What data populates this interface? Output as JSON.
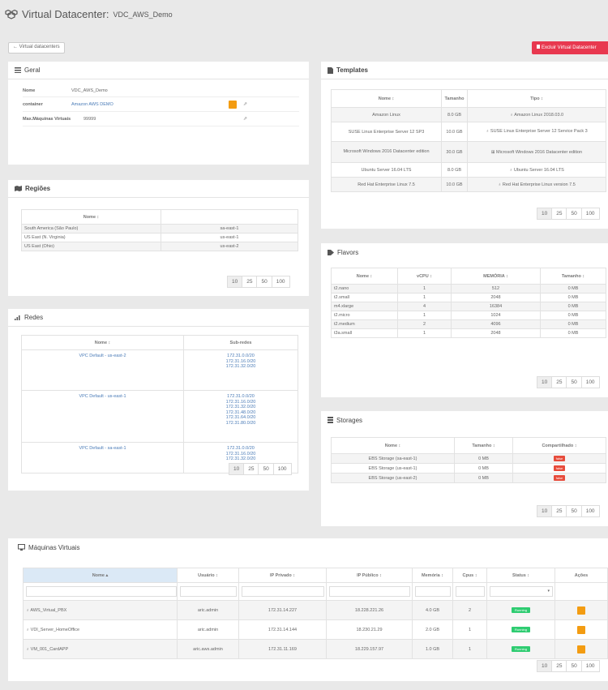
{
  "page": {
    "title_prefix": "Virtual Datacenter:",
    "title_name": "VDC_AWS_Demo"
  },
  "toolbar": {
    "back_label": "← Virtual datacenters",
    "delete_label": "Excluir Virtual Datacenter"
  },
  "geral": {
    "heading": "Geral",
    "rows": [
      {
        "label": "Nome",
        "value": "VDC_AWS_Demo"
      },
      {
        "label": "container",
        "value": "Amazon AWS DEMO"
      },
      {
        "label": "Max.Máquinas Virtuais",
        "value": "99999"
      }
    ]
  },
  "regioes": {
    "heading": "Regiões",
    "headers": [
      "Nome ↕",
      ""
    ],
    "rows": [
      [
        "South America (São Paulo)",
        "sa-east-1"
      ],
      [
        "US East (N. Virginia)",
        "us-east-1"
      ],
      [
        "US East (Ohio)",
        "us-east-2"
      ]
    ]
  },
  "redes": {
    "heading": "Redes",
    "headers": [
      "Nome ↕",
      "Sub-redes"
    ],
    "rows": [
      {
        "name": "VPC Default - us-east-2",
        "subnets": [
          "172.31.0.0/20",
          "172.31.16.0/20",
          "172.31.32.0/20"
        ]
      },
      {
        "name": "VPC Default - us-east-1",
        "subnets": [
          "172.31.0.0/20",
          "172.31.16.0/20",
          "172.31.32.0/20",
          "172.31.48.0/20",
          "172.31.64.0/20",
          "172.31.80.0/20"
        ]
      },
      {
        "name": "VPC Default - sa-east-1",
        "subnets": [
          "172.31.0.0/20",
          "172.31.16.0/20",
          "172.31.32.0/20"
        ]
      }
    ]
  },
  "templates": {
    "heading": "Templates",
    "headers": [
      "Nome ↕",
      "Tamanho",
      "Tipo ↕"
    ],
    "rows": [
      [
        "Amazon Linux",
        "8.0 GB",
        "Amazon Linux 2018.03.0"
      ],
      [
        "SUSE Linux Enterprise Server 12 SP3",
        "10.0 GB",
        "SUSE Linux Enterprise Server 12 Service Pack 3"
      ],
      [
        "Microsoft Windows 2016 Datacenter edition",
        "30.0 GB",
        "Microsoft Windows 2016 Datacenter edition"
      ],
      [
        "Ubuntu Server 16.04 LTS",
        "8.0 GB",
        "Ubuntu Server 16.04 LTS"
      ],
      [
        "Red Hat Enterprise Linux 7.5",
        "10.0 GB",
        "Red Hat Enterprise Linux version 7.5"
      ]
    ]
  },
  "flavors": {
    "heading": "Flavors",
    "headers": [
      "Nome ↕",
      "vCPU ↕",
      "MEMÓRIA ↕",
      "Tamanho ↕"
    ],
    "rows": [
      [
        "t2.nano",
        "1",
        "512",
        "0 MB"
      ],
      [
        "t2.small",
        "1",
        "2048",
        "0 MB"
      ],
      [
        "m4.xlarge",
        "4",
        "16384",
        "0 MB"
      ],
      [
        "t2.micro",
        "1",
        "1024",
        "0 MB"
      ],
      [
        "t2.medium",
        "2",
        "4096",
        "0 MB"
      ],
      [
        "t3a.small",
        "1",
        "2048",
        "0 MB"
      ]
    ]
  },
  "storages": {
    "heading": "Storages",
    "headers": [
      "Nome ↕",
      "Tamanho ↕",
      "Compartilhado ↕"
    ],
    "rows": [
      [
        "EBS Storage (sa-east-1)",
        "0 MB",
        "false"
      ],
      [
        "EBS Storage (us-east-1)",
        "0 MB",
        "false"
      ],
      [
        "EBS Storage (us-east-2)",
        "0 MB",
        "false"
      ]
    ]
  },
  "vms": {
    "heading": "Máquinas Virtuais",
    "headers": [
      "Nome ▴",
      "Usuário ↕",
      "IP Privado ↕",
      "IP Público ↕",
      "Memória ↕",
      "Cpus ↕",
      "Status ↕",
      "Ações"
    ],
    "rows": [
      [
        "AWS_Virtual_PBX",
        "aric.admin",
        "172.31.14.227",
        "18.228.221.26",
        "4.0 GB",
        "2",
        "Running"
      ],
      [
        "VDI_Server_HomeOffice",
        "aric.admin",
        "172.31.14.144",
        "18.230.21.29",
        "2.0 GB",
        "1",
        "Running"
      ],
      [
        "VM_001_CardAPP",
        "aric.aws.admin",
        "172.31.11.169",
        "18.229.157.97",
        "1.0 GB",
        "1",
        "Running"
      ]
    ]
  },
  "pagination": [
    "10",
    "25",
    "50",
    "100"
  ],
  "colors": {
    "accent_red": "#e8384f",
    "orange": "#f39c12",
    "green": "#2ecc71",
    "link": "#4a7bb7"
  }
}
